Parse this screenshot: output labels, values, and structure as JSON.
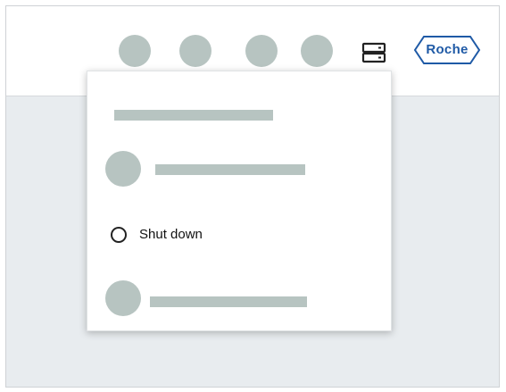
{
  "header": {
    "placeholder_dots": [
      "avatar-1",
      "avatar-2",
      "avatar-3",
      "avatar-4"
    ],
    "server_icon": "server-stack-icon",
    "logo_text": "Roche",
    "brand_color": "#1f5aa6",
    "placeholder_color": "#b7c4c1"
  },
  "menu": {
    "items": [
      {
        "type": "placeholder"
      },
      {
        "type": "placeholder-with-avatar"
      },
      {
        "type": "radio-option",
        "label": "Shut down",
        "selected": false
      },
      {
        "type": "placeholder-with-avatar"
      }
    ]
  }
}
